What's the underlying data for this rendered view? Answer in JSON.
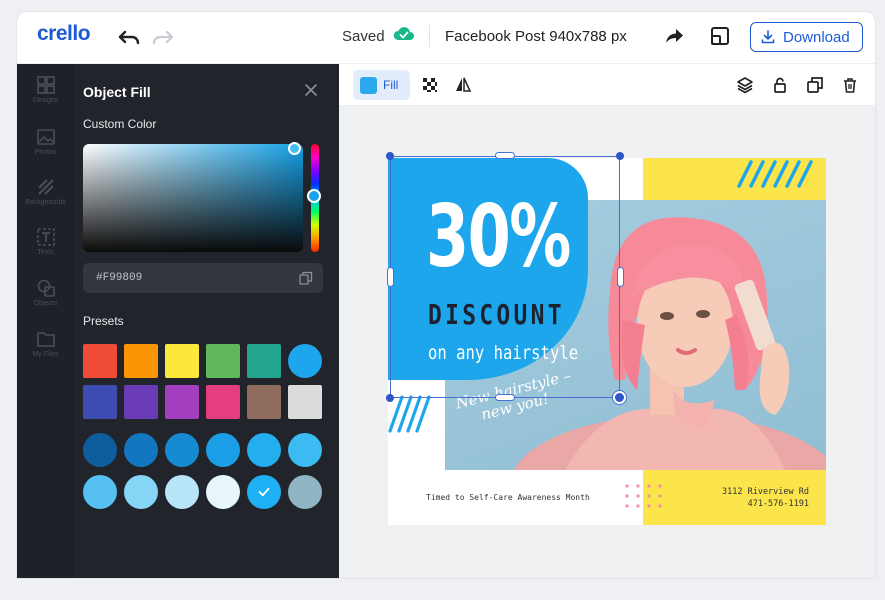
{
  "topbar": {
    "logo": "crello",
    "saved_label": "Saved",
    "doc_title": "Facebook Post 940x788 px",
    "download_label": "Download"
  },
  "rail": {
    "items": [
      {
        "label": "Designs",
        "icon": "designs-icon"
      },
      {
        "label": "Photos",
        "icon": "photos-icon"
      },
      {
        "label": "Backgrounds",
        "icon": "backgrounds-icon"
      },
      {
        "label": "Texts",
        "icon": "text-icon"
      },
      {
        "label": "Objects",
        "icon": "objects-icon"
      },
      {
        "label": "My Files",
        "icon": "folder-icon"
      }
    ]
  },
  "panel": {
    "title": "Object Fill",
    "custom_color_label": "Custom Color",
    "hex_value": "#F99809",
    "presets_label": "Presets",
    "preset_colors": [
      [
        "#f04b37",
        "#fb9506",
        "#fce83a",
        "#5fb95c",
        "#23a48f",
        "#1ea6ec"
      ],
      [
        "#3e4bb1",
        "#6a3bb6",
        "#a33fbf",
        "#e53e7e",
        "#8f6c5e",
        "#dcdcdc"
      ],
      [
        "#0e5d9c",
        "#1277c0",
        "#168bd4",
        "#1a9ee6",
        "#23aef0",
        "#3bbbf1"
      ],
      [
        "#56c0f3",
        "#86d4f6",
        "#b8e6f8",
        "#e8f6fc",
        "#1fb0f5",
        "#8fb5c4"
      ]
    ],
    "selected_preset": "3-4"
  },
  "context_bar": {
    "fill_label": "Fill",
    "fill_color": "#2aa9ee"
  },
  "design": {
    "big_text": "30%",
    "discount_text": "DISCOUNT",
    "subline": "on any hairstyle",
    "script_text_line1": "New hairstyle –",
    "script_text_line2": "new you!",
    "footer_left": "Timed to Self-Care Awareness Month",
    "address_line1": "3112 Riverview Rd",
    "address_line2": "471-576-1191",
    "accent_blue": "#1ea6ec",
    "accent_yellow": "#fbe54b",
    "accent_pink": "#f58fa8"
  },
  "colors": {
    "brand": "#1d5bd6",
    "panel_bg": "#22242b",
    "rail_bg": "#1f2128"
  }
}
